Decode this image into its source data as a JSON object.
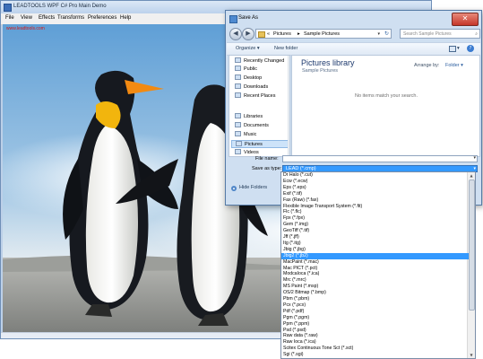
{
  "main_window": {
    "title": "LEADTOOLS WPF C# Pro Main Demo",
    "menu": [
      "File",
      "View",
      "Effects",
      "Transforms",
      "Preferences",
      "Help"
    ],
    "site_link": "www.leadtools.com"
  },
  "dialog": {
    "title": "Save As",
    "close_glyph": "✕",
    "address": {
      "prefix": "«",
      "crumb_1": "Pictures",
      "separator": "▸",
      "crumb_2": "Sample Pictures",
      "dropdown_glyph": "▾",
      "refresh_glyph": "↻"
    },
    "search": {
      "placeholder": "Search Sample Pictures",
      "icon": "search-icon"
    },
    "toolbar": {
      "organize": "Organize ▾",
      "new_folder": "New folder",
      "view_glyph": "▾",
      "help_glyph": "?"
    },
    "nav_items": [
      {
        "label": "Recently Changed",
        "icon": "recent-icon",
        "selected": false
      },
      {
        "label": "Public",
        "icon": "folder-icon",
        "selected": false
      },
      {
        "label": "Desktop",
        "icon": "desktop-icon",
        "selected": false
      },
      {
        "label": "Downloads",
        "icon": "downloads-icon",
        "selected": false
      },
      {
        "label": "Recent Places",
        "icon": "recent-places-icon",
        "selected": false
      },
      {
        "label": "Libraries",
        "icon": "libraries-icon",
        "selected": false
      },
      {
        "label": "Documents",
        "icon": "documents-icon",
        "selected": false
      },
      {
        "label": "Music",
        "icon": "music-icon",
        "selected": false
      },
      {
        "label": "Pictures",
        "icon": "pictures-icon",
        "selected": true
      },
      {
        "label": "Videos",
        "icon": "videos-icon",
        "selected": false
      }
    ],
    "content": {
      "title": "Pictures library",
      "subtitle": "Sample Pictures",
      "arrange_label": "Arrange by:",
      "arrange_value": "Folder ▾",
      "empty_message": "No items match your search."
    },
    "file_name_label": "File name:",
    "file_name_value": "",
    "save_type_label": "Save as type:",
    "save_type_value": "LEAD (*.cmp)",
    "hide_folders": "Hide Folders",
    "hide_folders_glyph": "▲"
  },
  "type_options": [
    "Dr Halo (*.cut)",
    "Ecw (*.ecw)",
    "Eps (*.eps)",
    "Exif (*.tif)",
    "Fax (Raw) (*.fax)",
    "Flexible Image Transport System (*.fit)",
    "Flc (*.flc)",
    "Fpx (*.fpx)",
    "Gem (*.img)",
    "GeoTiff (*.tif)",
    "Jff (*.jff)",
    "Itg (*.itg)",
    "Jbig (*.jbg)",
    "Jbig2 (*.jb2)",
    "MacPaint (*.mac)",
    "Mac PICT (*.pct)",
    "ModcaIoca (*.ica)",
    "Mrc (*.mrc)",
    "MS Paint (*.msp)",
    "OS/2 Bitmap (*.bmp)",
    "Pbm (*.pbm)",
    "Pcx (*.pcx)",
    "Pdf (*.pdf)",
    "Pgm (*.pgm)",
    "Ppm (*.ppm)",
    "Psd (*.psd)",
    "Raw data (*.raw)",
    "Raw Ioca (*.ica)",
    "Scitex Continuous Tone Sct (*.sct)",
    "Sgi (*.sgi)"
  ],
  "selected_option_index": 13,
  "colors": {
    "selection": "#3399ff",
    "link": "#d21919",
    "library_title": "#1e3a6e"
  }
}
